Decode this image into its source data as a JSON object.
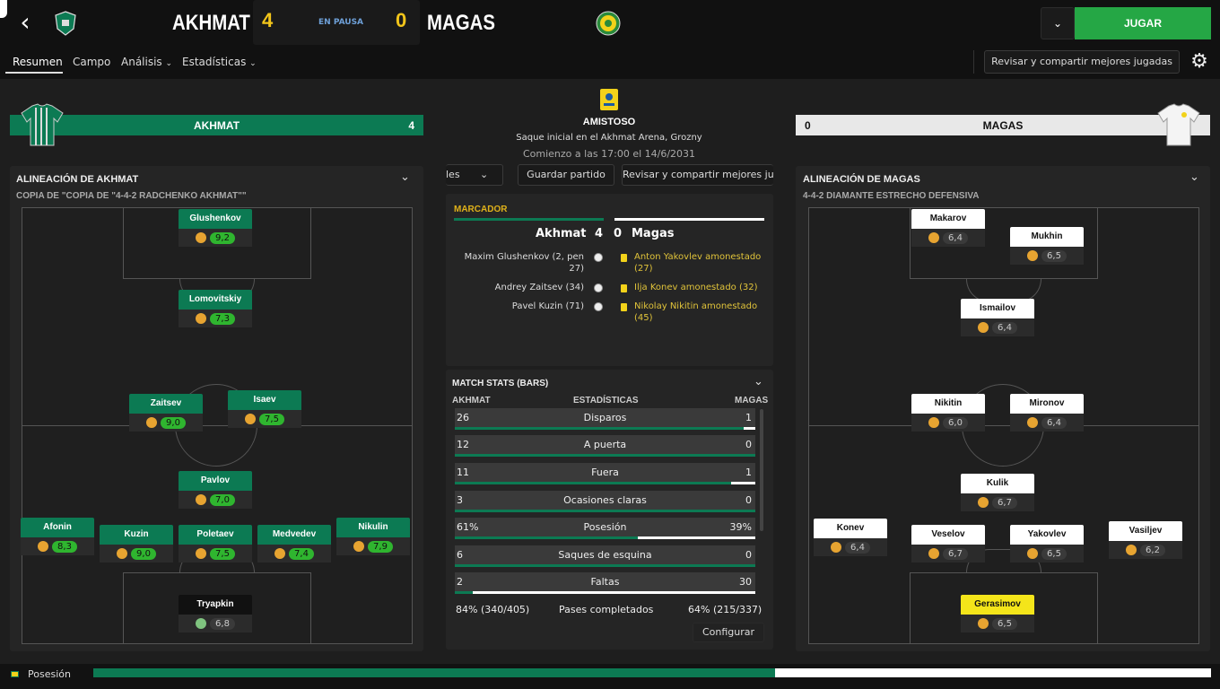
{
  "header": {
    "home_team": "AKHMAT",
    "away_team": "MAGAS",
    "home_score": "4",
    "away_score": "0",
    "status": "EN PAUSA",
    "play_label": "JUGAR",
    "dropdown_icon": "chevron-down-icon",
    "back_icon": "back-arrow-icon"
  },
  "nav": {
    "tabs": [
      "Resumen",
      "Campo",
      "Análisis",
      "Estadísticas"
    ],
    "revisar_label": "Revisar y compartir mejores jugadas",
    "settings_icon": "gear-icon"
  },
  "match": {
    "competition": "AMISTOSO",
    "kickoff_info": "Saque inicial en el Akhmat Arena, Grozny",
    "start_time": "Comienzo a las 17:00 el 14/6/2031",
    "buttons": {
      "partial": "les",
      "save": "Guardar partido",
      "revisar_partial": "Revisar y compartir mejores ju"
    }
  },
  "home": {
    "name": "AKHMAT",
    "score": "4",
    "lineup_title": "ALINEACIÓN DE AKHMAT",
    "formation": "COPIA DE \"COPIA DE \"4-4-2 RADCHENKO AKHMAT\"\"",
    "players": [
      {
        "name": "Glushenkov",
        "rating": "9,2",
        "best": true
      },
      {
        "name": "Lomovitskiy",
        "rating": "7,3",
        "best": true
      },
      {
        "name": "Zaitsev",
        "rating": "9,0",
        "best": true
      },
      {
        "name": "Isaev",
        "rating": "7,5",
        "best": true
      },
      {
        "name": "Pavlov",
        "rating": "7,0",
        "best": true
      },
      {
        "name": "Afonin",
        "rating": "8,3",
        "best": true
      },
      {
        "name": "Kuzin",
        "rating": "9,0",
        "best": true
      },
      {
        "name": "Poletaev",
        "rating": "7,5",
        "best": true
      },
      {
        "name": "Medvedev",
        "rating": "7,4",
        "best": true
      },
      {
        "name": "Nikulin",
        "rating": "7,9",
        "best": true
      },
      {
        "name": "Tryapkin",
        "rating": "6,8",
        "best": false
      }
    ]
  },
  "away": {
    "name": "MAGAS",
    "score": "0",
    "lineup_title": "ALINEACIÓN DE MAGAS",
    "formation": "4-4-2 DIAMANTE ESTRECHO DEFENSIVA",
    "players": [
      {
        "name": "Makarov",
        "rating": "6,4"
      },
      {
        "name": "Mukhin",
        "rating": "6,5"
      },
      {
        "name": "Ismailov",
        "rating": "6,4"
      },
      {
        "name": "Nikitin",
        "rating": "6,0"
      },
      {
        "name": "Mironov",
        "rating": "6,4"
      },
      {
        "name": "Kulik",
        "rating": "6,7"
      },
      {
        "name": "Konev",
        "rating": "6,4"
      },
      {
        "name": "Veselov",
        "rating": "6,7"
      },
      {
        "name": "Yakovlev",
        "rating": "6,5"
      },
      {
        "name": "Vasiljev",
        "rating": "6,2"
      },
      {
        "name": "Gerasimov",
        "rating": "6,5"
      }
    ]
  },
  "scoreboard": {
    "title": "MARCADOR",
    "home": "Akhmat",
    "away": "Magas",
    "home_goals": "4",
    "away_goals": "0",
    "home_events": [
      "Maxim Glushenkov (2, pen",
      "27)",
      "Andrey Zaitsev (34)",
      "Pavel Kuzin (71)"
    ],
    "away_events": [
      "Anton Yakovlev amonestado",
      "(27)",
      "Ilja Konev amonestado (32)",
      "Nikolay Nikitin amonestado",
      "(45)"
    ]
  },
  "stats": {
    "title": "MATCH STATS (BARS)",
    "col_home": "AKHMAT",
    "col_label": "ESTADÍSTICAS",
    "col_away": "MAGAS",
    "configure": "Configurar",
    "rows": [
      {
        "label": "Disparos",
        "home": "26",
        "away": "1",
        "home_share": 0.96
      },
      {
        "label": "A puerta",
        "home": "12",
        "away": "0",
        "home_share": 1.0
      },
      {
        "label": "Fuera",
        "home": "11",
        "away": "1",
        "home_share": 0.92
      },
      {
        "label": "Ocasiones claras",
        "home": "3",
        "away": "0",
        "home_share": 1.0
      },
      {
        "label": "Posesión",
        "home": "61%",
        "away": "39%",
        "home_share": 0.61
      },
      {
        "label": "Saques de esquina",
        "home": "6",
        "away": "0",
        "home_share": 1.0
      },
      {
        "label": "Faltas",
        "home": "2",
        "away": "30",
        "home_share": 0.06
      },
      {
        "label": "Pases completados",
        "home": "84% (340/405)",
        "away": "64% (215/337)",
        "home_share": null
      }
    ]
  },
  "footer": {
    "label": "Posesión",
    "home_share": 0.61,
    "colors": {
      "home": "#0c7a53",
      "away": "#ffffff"
    }
  },
  "colors": {
    "home": "#0c7a53",
    "away": "#ffffff",
    "accent": "#25a745",
    "score": "#f2c51a"
  }
}
